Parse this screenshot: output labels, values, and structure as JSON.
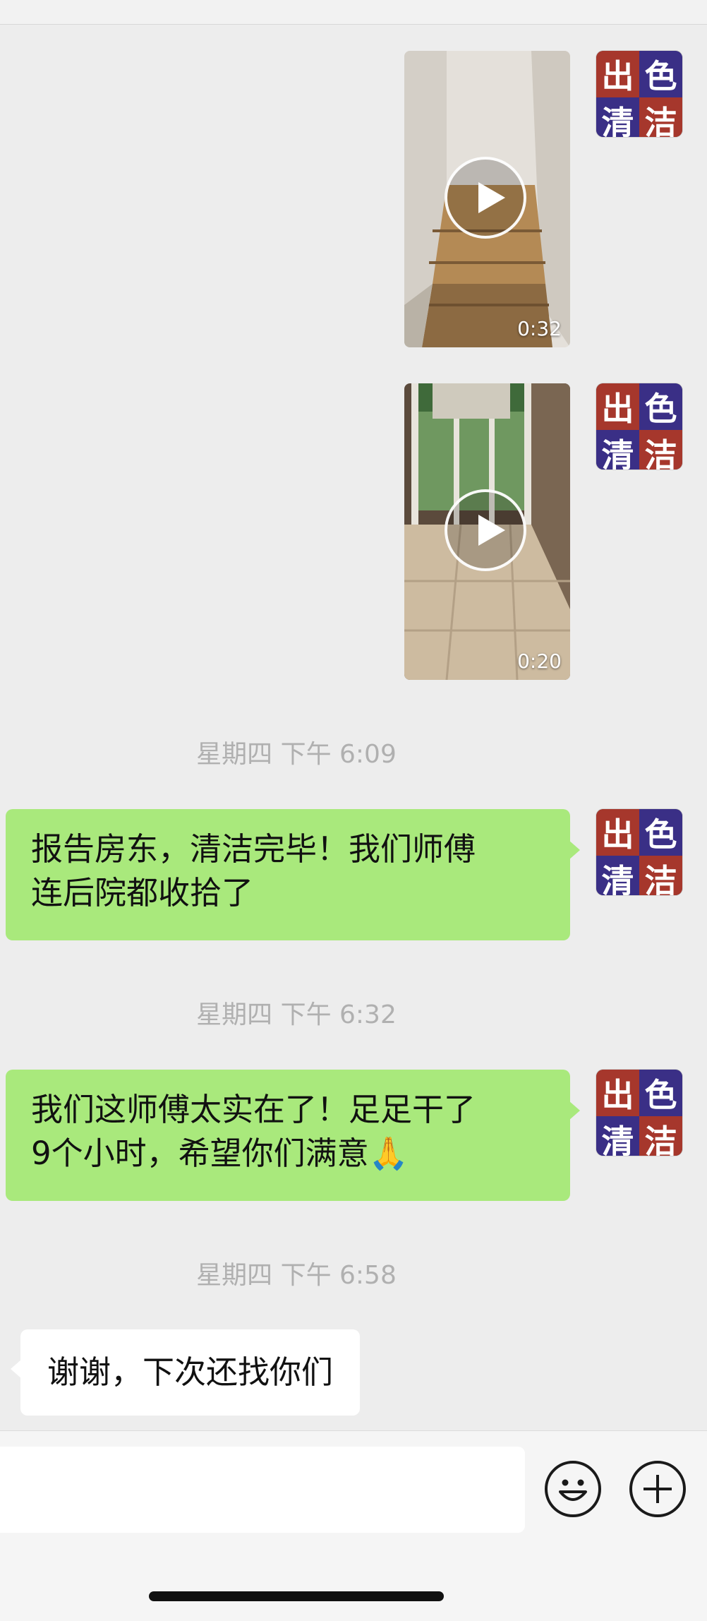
{
  "avatar": {
    "chars": [
      "出",
      "色",
      "清",
      "洁"
    ]
  },
  "videos": [
    {
      "duration": "0:32"
    },
    {
      "duration": "0:20"
    }
  ],
  "timestamps": [
    "星期四 下午 6:09",
    "星期四 下午 6:32",
    "星期四 下午 6:58"
  ],
  "messages": [
    {
      "from": "me",
      "lines": [
        "报告房东，清洁完毕！我们师傅",
        "连后院都收拾了"
      ]
    },
    {
      "from": "me",
      "lines": [
        "我们这师傅太实在了！足足干了",
        "9个小时，希望你们满意🙏"
      ]
    },
    {
      "from": "other",
      "lines": [
        "谢谢，下次还找你们"
      ]
    }
  ],
  "input": {
    "value": ""
  },
  "icons": {
    "emoji": "emoji-icon",
    "plus": "plus-icon",
    "play": "play-icon"
  }
}
